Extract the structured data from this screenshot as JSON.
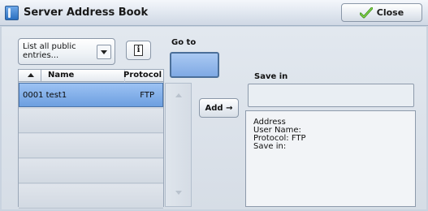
{
  "window": {
    "title": "Server Address Book",
    "close_label": "Close"
  },
  "filter": {
    "selected": "List all public entries..."
  },
  "goto": {
    "label": "Go to",
    "value": ""
  },
  "list": {
    "columns": {
      "name": "Name",
      "protocol": "Protocol"
    },
    "rows": [
      {
        "name": "0001  test1",
        "protocol": "FTP",
        "selected": true
      }
    ]
  },
  "add_label": "Add →",
  "save_in": {
    "label": "Save in",
    "value": ""
  },
  "details": {
    "address": "Address",
    "user_name": "User Name:",
    "protocol": "Protocol: FTP",
    "save_in": "Save in:"
  },
  "colors": {
    "selection": "#7fa9e4",
    "background": "#d6dde6",
    "close_icon": "#6fbf3a"
  },
  "icons": [
    "address-book-icon",
    "checkmark-icon",
    "dropdown-arrow-icon",
    "info-icon",
    "sort-ascending-icon",
    "scroll-up-icon",
    "scroll-down-icon",
    "arrow-right-icon"
  ]
}
